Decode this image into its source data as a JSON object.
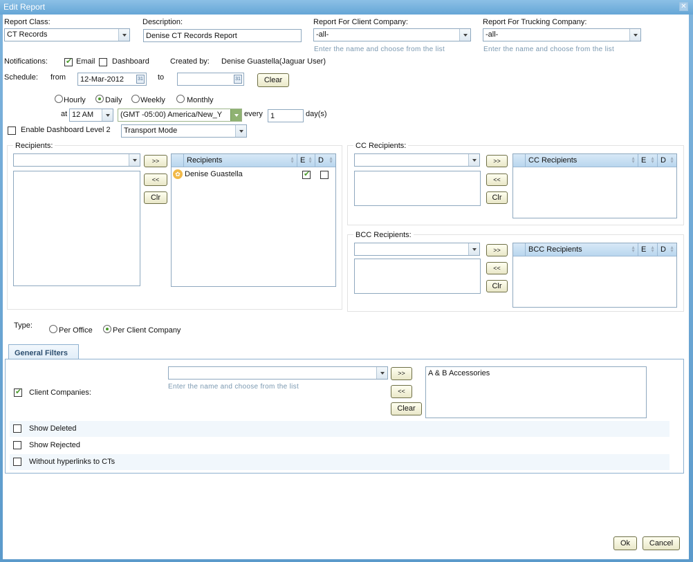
{
  "window": {
    "title": "Edit Report",
    "close_icon": "close-icon"
  },
  "report_class": {
    "label": "Report Class:",
    "value": "CT Records"
  },
  "description": {
    "label": "Description:",
    "value": "Denise CT Records Report"
  },
  "client_company": {
    "label": "Report For Client Company:",
    "value": "-all-",
    "hint": "Enter the name and choose from the list"
  },
  "trucking_company": {
    "label": "Report For Trucking Company:",
    "value": "-all-",
    "hint": "Enter the name and choose from the list"
  },
  "notifications": {
    "label": "Notifications:",
    "email_label": "Email",
    "email_checked": true,
    "dashboard_label": "Dashboard",
    "dashboard_checked": false
  },
  "created_by": {
    "label": "Created by:",
    "value": "Denise Guastella(Jaguar User)"
  },
  "schedule": {
    "label": "Schedule:",
    "from_label": "from",
    "from_value": "12-Mar-2012",
    "to_label": "to",
    "to_value": "",
    "clear_label": "Clear",
    "calendar_glyph": "31",
    "frequency_options": [
      "Hourly",
      "Daily",
      "Weekly",
      "Monthly"
    ],
    "frequency_selected": "Daily",
    "at_label": "at",
    "time_value": "12 AM",
    "timezone_value": "(GMT -05:00) America/New_Y",
    "every_label": "every",
    "every_value": "1",
    "unit_label": "day(s)"
  },
  "dashboard_level": {
    "label": "Enable Dashboard Level 2",
    "checked": false,
    "mode_value": "Transport Mode"
  },
  "recipients": {
    "legend": "Recipients:",
    "add": ">>",
    "remove": "<<",
    "clear": "Clr",
    "grid_headers": [
      "Recipients",
      "E",
      "D"
    ],
    "rows": [
      {
        "name": "Denise Guastella",
        "icon": "user-icon",
        "e": true,
        "d": false
      }
    ]
  },
  "cc_recipients": {
    "legend": "CC Recipients:",
    "add": ">>",
    "remove": "<<",
    "clear": "Clr",
    "grid_headers": [
      "CC Recipients",
      "E",
      "D"
    ],
    "rows": []
  },
  "bcc_recipients": {
    "legend": "BCC Recipients:",
    "add": ">>",
    "remove": "<<",
    "clear": "Clr",
    "grid_headers": [
      "BCC Recipients",
      "E",
      "D"
    ],
    "rows": []
  },
  "type": {
    "label": "Type:",
    "options": [
      "Per Office",
      "Per Client Company"
    ],
    "selected": "Per Client Company"
  },
  "tabs": [
    {
      "label": "General Filters",
      "active": true
    }
  ],
  "filters": {
    "client_companies": {
      "label": "Client Companies:",
      "checked": true,
      "input_value": "",
      "hint": "Enter the name and choose from the list",
      "add": ">>",
      "remove": "<<",
      "clear": "Clear",
      "selected": [
        "A & B Accessories"
      ]
    },
    "options": [
      {
        "label": "Show Deleted",
        "checked": false
      },
      {
        "label": "Show Rejected",
        "checked": false
      },
      {
        "label": "Without hyperlinks to CTs",
        "checked": false
      }
    ]
  },
  "footer": {
    "ok": "Ok",
    "cancel": "Cancel"
  }
}
